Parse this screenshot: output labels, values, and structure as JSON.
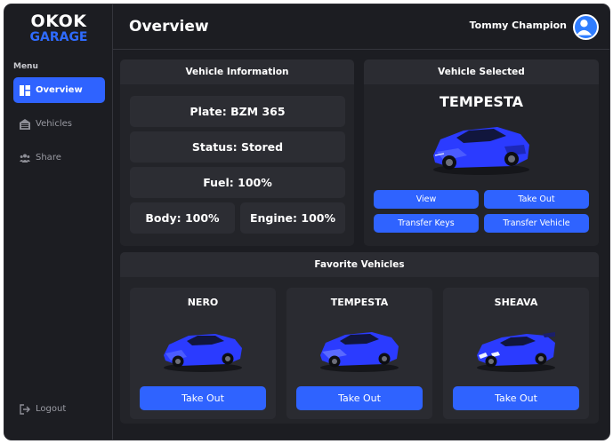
{
  "logo": {
    "top": "OKOK",
    "bottom": "GARAGE"
  },
  "sidebar": {
    "menu_heading": "Menu",
    "items": [
      {
        "label": "Overview",
        "icon": "dashboard-icon",
        "active": true
      },
      {
        "label": "Vehicles",
        "icon": "garage-icon",
        "active": false
      },
      {
        "label": "Share",
        "icon": "users-icon",
        "active": false
      }
    ],
    "logout_label": "Logout"
  },
  "header": {
    "title": "Overview",
    "user_name": "Tommy Champion"
  },
  "vehicle_info": {
    "title": "Vehicle Information",
    "plate": "Plate: BZM 365",
    "status": "Status: Stored",
    "fuel": "Fuel: 100%",
    "body": "Body: 100%",
    "engine": "Engine: 100%"
  },
  "vehicle_selected": {
    "title": "Vehicle Selected",
    "name": "TEMPESTA",
    "buttons": {
      "view": "View",
      "take_out": "Take Out",
      "transfer_keys": "Transfer Keys",
      "transfer_vehicle": "Transfer Vehicle"
    }
  },
  "favorites": {
    "title": "Favorite Vehicles",
    "cards": [
      {
        "name": "NERO",
        "button": "Take Out"
      },
      {
        "name": "TEMPESTA",
        "button": "Take Out"
      },
      {
        "name": "SHEAVA",
        "button": "Take Out"
      }
    ]
  },
  "colors": {
    "accent": "#2f63ff",
    "background": "#1c1d22",
    "panel": "#232429",
    "car_body": "#2b3bff"
  }
}
